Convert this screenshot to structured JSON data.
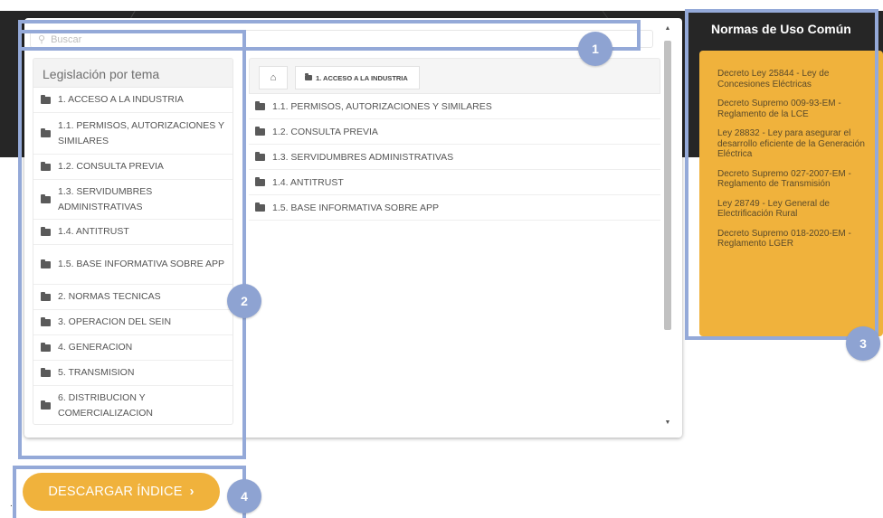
{
  "search": {
    "placeholder": "Buscar"
  },
  "sidebar": {
    "title": "Legislación por tema",
    "items": [
      {
        "label": "1. ACCESO A LA INDUSTRIA"
      },
      {
        "label": "1.1. PERMISOS, AUTORIZACIONES Y SIMILARES"
      },
      {
        "label": "1.2. CONSULTA PREVIA"
      },
      {
        "label": "1.3. SERVIDUMBRES ADMINISTRATIVAS"
      },
      {
        "label": "1.4. ANTITRUST"
      },
      {
        "label": "1.5. BASE INFORMATIVA SOBRE APP"
      },
      {
        "label": "2. NORMAS TECNICAS"
      },
      {
        "label": "3. OPERACION DEL SEIN"
      },
      {
        "label": "4. GENERACION"
      },
      {
        "label": "5. TRANSMISION"
      },
      {
        "label": "6. DISTRIBUCION Y COMERCIALIZACION"
      }
    ]
  },
  "breadcrumb": {
    "home_icon": "home-icon",
    "current": "1. ACCESO A LA INDUSTRIA"
  },
  "main_list": [
    {
      "label": "1.1. PERMISOS, AUTORIZACIONES Y SIMILARES"
    },
    {
      "label": "1.2. CONSULTA PREVIA"
    },
    {
      "label": "1.3. SERVIDUMBRES ADMINISTRATIVAS"
    },
    {
      "label": "1.4. ANTITRUST"
    },
    {
      "label": "1.5. BASE INFORMATIVA SOBRE APP"
    }
  ],
  "normas": {
    "title": "Normas de Uso Común",
    "items": [
      {
        "text": "Decreto Ley 25844 - Ley de Concesiones Eléctricas"
      },
      {
        "text": "Decreto Supremo 009-93-EM - Reglamento de la LCE"
      },
      {
        "text": "Ley 28832 - Ley para asegurar el desarrollo eficiente de la Generación Eléctrica"
      },
      {
        "text": "Decreto Supremo 027-2007-EM - Reglamento de Transmisión"
      },
      {
        "text": "Ley 28749 - Ley General de Electrificación Rural"
      },
      {
        "text": "Decreto Supremo 018-2020-EM - Reglamento LGER"
      }
    ]
  },
  "download": {
    "label": "DESCARGAR ÍNDICE",
    "chevron": "›"
  },
  "annotations": [
    "1",
    "2",
    "3",
    "4"
  ],
  "colors": {
    "accent": "#f0b23c",
    "annotation": "#8ea3d2",
    "header": "#262626"
  }
}
